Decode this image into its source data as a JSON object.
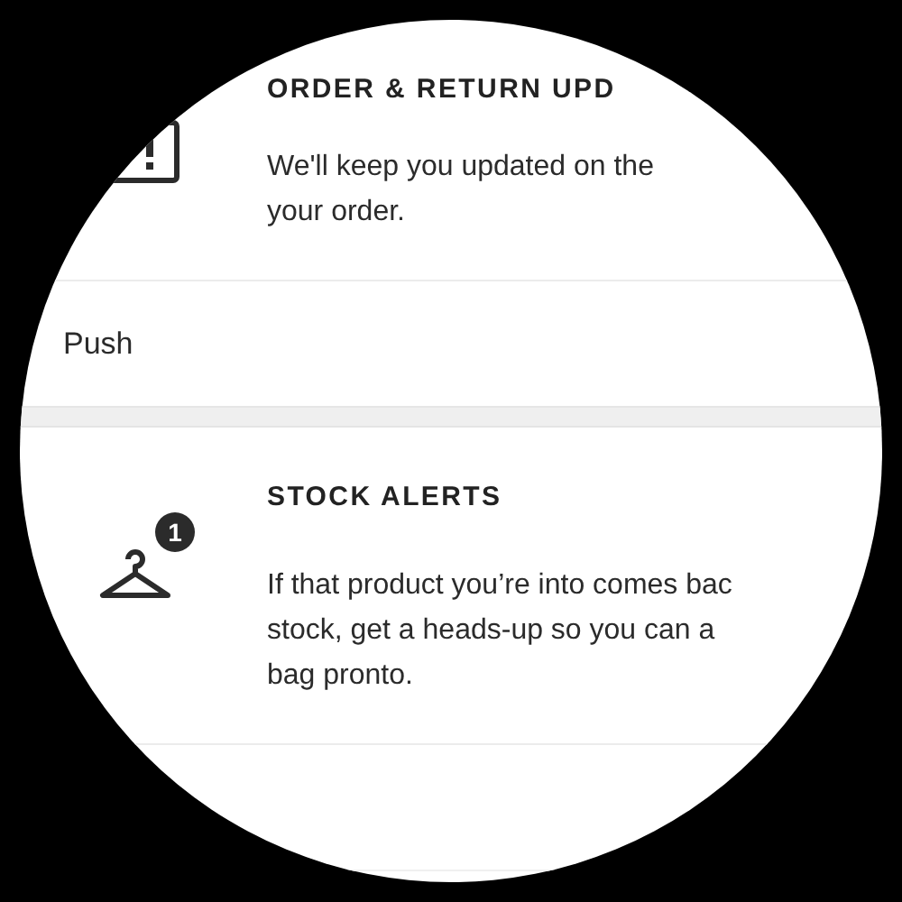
{
  "notifications": [
    {
      "kind": "order",
      "title": "ORDER & RETURN UPD",
      "description": [
        "We'll keep you updated on the",
        "your order."
      ],
      "channels": [
        {
          "label": "Push"
        }
      ]
    },
    {
      "kind": "stock",
      "badge": "1",
      "title": "STOCK ALERTS",
      "description": [
        "If that product you’re into comes bac",
        "stock, get a heads-up so you can a",
        "bag pronto."
      ]
    }
  ]
}
